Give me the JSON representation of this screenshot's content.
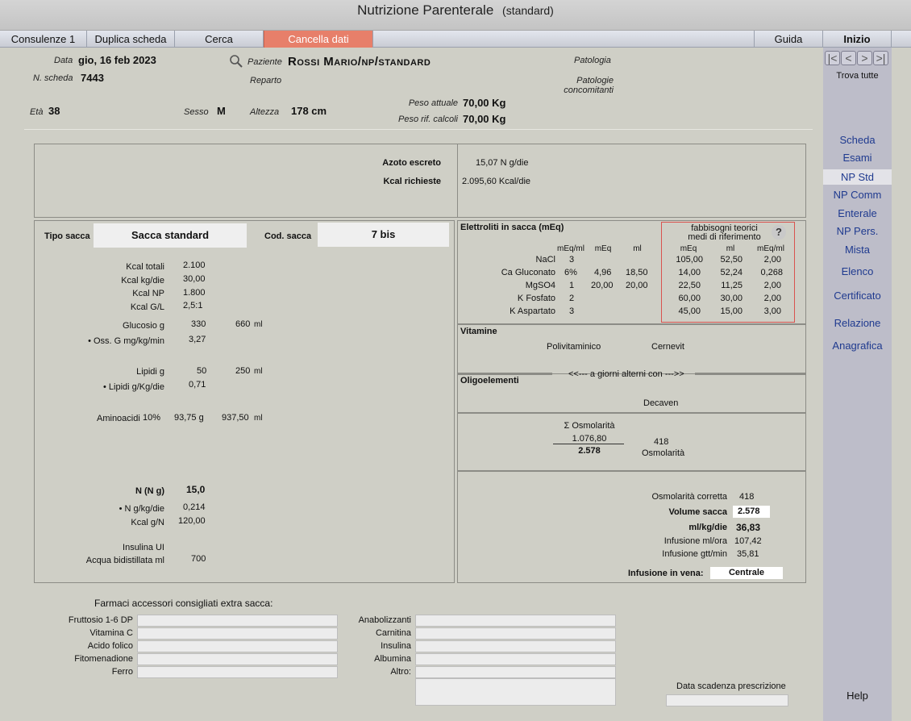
{
  "window": {
    "title": "Nutrizione  Parenterale",
    "subtitle": "(standard)"
  },
  "menu": {
    "consulenze": "Consulenze 1",
    "duplica": "Duplica scheda",
    "cerca": "Cerca",
    "cancella": "Cancella dati",
    "guida": "Guida",
    "inizio": "Inizio"
  },
  "sidebar": {
    "nav": [
      "|<",
      "<",
      ">",
      ">|"
    ],
    "trova": "Trova tutte",
    "links": [
      "Scheda",
      "Esami",
      "NP Std",
      "NP Comm",
      "Enterale",
      "NP Pers.",
      "Mista",
      "Elenco",
      "Certificato",
      "Relazione",
      "Anagrafica"
    ],
    "help": "Help"
  },
  "header": {
    "data_label": "Data",
    "data_value": "gio, 16 feb 2023",
    "scheda_label": "N. scheda",
    "scheda_value": "7443",
    "paziente_label": "Paziente",
    "paziente_value": "Rossi Mario/np/standard",
    "reparto_label": "Reparto",
    "patologia_label": "Patologia",
    "patologie_conc_label": "Patologie concomitanti",
    "eta_label": "Età",
    "eta_value": "38",
    "sesso_label": "Sesso",
    "sesso_value": "M",
    "altezza_label": "Altezza",
    "altezza_value": "178 cm",
    "peso_label": "Peso attuale",
    "peso_value": "70,00 Kg",
    "peso_rif_label": "Peso rif. calcoli",
    "peso_rif_value": "70,00 Kg"
  },
  "top_panel": {
    "azoto_label": "Azoto escreto",
    "azoto_value": "15,07 N g/die",
    "kcal_label": "Kcal richieste",
    "kcal_value": "2.095,60 Kcal/die"
  },
  "sacca": {
    "tipo_label": "Tipo sacca",
    "tipo_value": "Sacca standard",
    "cod_label": "Cod. sacca",
    "cod_value": "7 bis",
    "rows": [
      {
        "label": "Kcal totali",
        "value": "2.100"
      },
      {
        "label": "Kcal kg/die",
        "value": "30,00"
      },
      {
        "label": "Kcal NP",
        "value": "1.800"
      },
      {
        "label": "Kcal G/L",
        "value": "2,5:1"
      }
    ],
    "glucosio_label": "Glucosio g",
    "glucosio_g": "330",
    "glucosio_ml": "660",
    "oss_label": "• Oss. G mg/kg/min",
    "oss_value": "3,27",
    "lipidi_label": "Lipidi  g",
    "lipidi_g": "50",
    "lipidi_ml": "250",
    "lipidi_kg_label": "• Lipidi g/Kg/die",
    "lipidi_kg_value": "0,71",
    "ml_unit": "ml",
    "amino_label": "Aminoacidi",
    "amino_pct": "10%",
    "amino_g": "93,75 g",
    "amino_ml": "937,50",
    "n_label": "N  (N g)",
    "n_value": "15,0",
    "n_kg_label": "• N g/kg/die",
    "n_kg_value": "0,214",
    "kcal_gn_label": "Kcal g/N",
    "kcal_gn_value": "120,00",
    "insulina_label": "Insulina UI",
    "acqua_label": "Acqua bidistillata ml",
    "acqua_value": "700"
  },
  "elettroliti": {
    "title": "Elettroliti in sacca (mEq)",
    "headers": [
      "mEq/ml",
      "mEq",
      "ml"
    ],
    "rows": [
      {
        "name": "NaCl",
        "meqml": "3",
        "meq": "",
        "ml": ""
      },
      {
        "name": "Ca Gluconato",
        "meqml": "6%",
        "meq": "4,96",
        "ml": "18,50"
      },
      {
        "name": "MgSO4",
        "meqml": "1",
        "meq": "20,00",
        "ml": "20,00"
      },
      {
        "name": "K Fosfato",
        "meqml": "2",
        "meq": "",
        "ml": ""
      },
      {
        "name": "K Aspartato",
        "meqml": "3",
        "meq": "",
        "ml": ""
      }
    ],
    "ref_title1": "fabbisogni teorici",
    "ref_title2": "medi di riferimento",
    "ref_headers": [
      "mEq",
      "ml",
      "mEq/ml"
    ],
    "ref_rows": [
      [
        "105,00",
        "52,50",
        "2,00"
      ],
      [
        "14,00",
        "52,24",
        "0,268"
      ],
      [
        "22,50",
        "11,25",
        "2,00"
      ],
      [
        "60,00",
        "30,00",
        "2,00"
      ],
      [
        "45,00",
        "15,00",
        "3,00"
      ]
    ],
    "help": "?"
  },
  "vitamine": {
    "title": "Vitamine",
    "item1": "Polivitaminico",
    "item2": "Cernevit",
    "alterni": "<<--- a giorni alterni con --->>"
  },
  "oligo": {
    "title": "Oligoelementi",
    "item": "Decaven"
  },
  "osm": {
    "sigma": "Σ Osmolarità",
    "num": "1.076,80",
    "den": "2.578",
    "result": "418",
    "result_label": "Osmolarità"
  },
  "summary": {
    "osm_corr_label": "Osmolarità corretta",
    "osm_corr_value": "418",
    "volume_label": "Volume sacca",
    "volume_value": "2.578",
    "mlkg_label": "ml/kg/die",
    "mlkg_value": "36,83",
    "inf_ora_label": "Infusione ml/ora",
    "inf_ora_value": "107,42",
    "inf_gtt_label": "Infusione gtt/min",
    "inf_gtt_value": "35,81",
    "vena_label": "Infusione in vena:",
    "vena_value": "Centrale"
  },
  "farmaci": {
    "title": "Farmaci accessori consigliati extra sacca:",
    "left": [
      "Fruttosio 1-6 DP",
      "Vitamina C",
      "Acido folico",
      "Fitomenadione",
      "Ferro"
    ],
    "right": [
      "Anabolizzanti",
      "Carnitina",
      "Insulina",
      "Albumina",
      "Altro:"
    ],
    "scadenza": "Data scadenza prescrizione"
  }
}
